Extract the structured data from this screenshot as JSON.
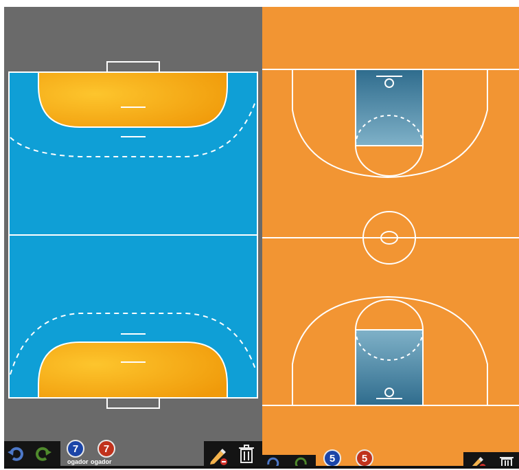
{
  "handball_court": {
    "name": "handball",
    "colors": {
      "background": "#6a6a6a",
      "court": "#0f9fd6",
      "goal_area": "#f7ab12",
      "lines": "#ffffff"
    }
  },
  "basketball_court": {
    "name": "basketball",
    "colors": {
      "court": "#f29533",
      "paint": "#3d87a8",
      "lines": "#ffffff"
    }
  },
  "handball_toolbar": {
    "tokens": [
      {
        "number": "7",
        "team": "blue",
        "label": "ogador"
      },
      {
        "number": "7",
        "team": "red",
        "label": "ogador"
      }
    ],
    "icons": [
      "undo-icon",
      "redo-icon",
      "pencil-icon",
      "trash-icon"
    ]
  },
  "basketball_toolbar": {
    "tokens": [
      {
        "number": "5",
        "team": "blue"
      },
      {
        "number": "5",
        "team": "red"
      }
    ],
    "icons": [
      "undo-icon",
      "redo-icon",
      "pencil-icon",
      "trash-icon"
    ]
  }
}
